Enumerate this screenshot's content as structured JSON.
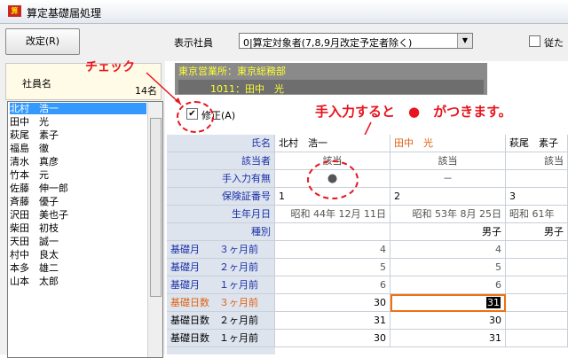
{
  "window": {
    "title": "算定基礎届処理",
    "icon": "app-icon"
  },
  "toolbar": {
    "modify_button": "改定(R)",
    "display_label": "表示社員",
    "display_select": "0|算定対象者(7,8,9月改定予定者除く)",
    "right_checkbox_label": "従た"
  },
  "employee_panel": {
    "header_label": "社員名",
    "count": "14名",
    "employees": [
      "北村　浩一",
      "田中　光",
      "萩尾　素子",
      "福島　徹",
      "清水　真彦",
      "竹本　元",
      "佐藤　伸一郎",
      "斉藤　優子",
      "沢田　美也子",
      "柴田　初枝",
      "天田　誠一",
      "村中　良太",
      "本多　雄二",
      "山本　太郎"
    ],
    "selected_index": 0
  },
  "org": {
    "line1": "東京営業所：東京総務部",
    "line2": "1011：田中　光"
  },
  "modify_checkbox": {
    "label": "修正(A)",
    "checked": true
  },
  "annotations": {
    "check": "チェック",
    "manual_entry": "手入力すると　●　がつきます。"
  },
  "grid": {
    "name_header": "氏名",
    "columns": [
      {
        "name": "北村　浩一"
      },
      {
        "name": "田中　光"
      },
      {
        "name": "萩尾　素子"
      }
    ],
    "rows": [
      {
        "label": "該当者",
        "values": [
          "該当",
          "該当",
          "該当"
        ]
      },
      {
        "label": "手入力有無",
        "values": [
          "●",
          "－",
          ""
        ]
      },
      {
        "label": "保険証番号",
        "values": [
          "1",
          "2",
          "3"
        ]
      },
      {
        "label": "生年月日",
        "values": [
          "昭和 44年 12月 11日",
          "昭和 53年  8月 25日",
          "昭和 61年"
        ]
      },
      {
        "label": "種別",
        "values": [
          "",
          "男子",
          "男子"
        ]
      },
      {
        "label": "基礎月　　３ヶ月前",
        "values": [
          "4",
          "4",
          ""
        ]
      },
      {
        "label": "基礎月　　２ヶ月前",
        "values": [
          "5",
          "5",
          ""
        ]
      },
      {
        "label": "基礎月　　１ヶ月前",
        "values": [
          "6",
          "6",
          ""
        ]
      },
      {
        "label": "基礎日数　３ヶ月前",
        "values": [
          "30",
          "31",
          ""
        ]
      },
      {
        "label": "基礎日数　２ヶ月前",
        "values": [
          "31",
          "30",
          ""
        ]
      },
      {
        "label": "基礎日数　１ヶ月前",
        "values": [
          "30",
          "31",
          ""
        ]
      }
    ],
    "colors": {
      "header_bg": "#dde4ee",
      "label_blue": "#1a2fa8",
      "label_orange": "#e06010",
      "highlight_col": "#e06010",
      "selected_border": "#f07010",
      "note_red": "#e8141e"
    }
  }
}
